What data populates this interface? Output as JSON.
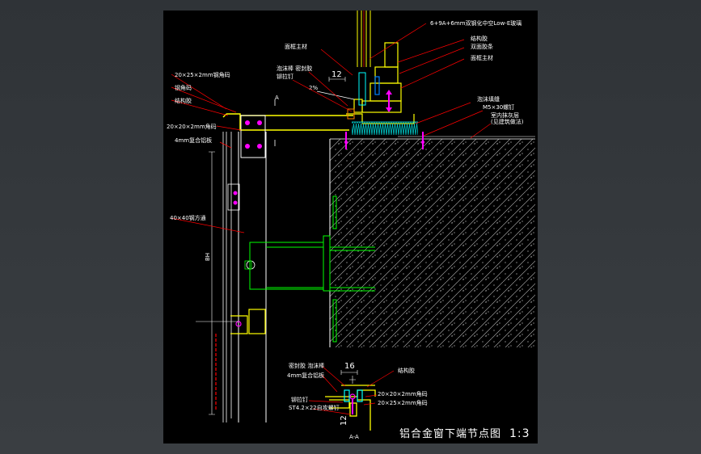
{
  "drawing": {
    "title": "铝合金窗下端节点图",
    "scale": "1:3",
    "section_mark": "A-A"
  },
  "labels": {
    "glass": "6+9A+6mm双钢化中空Low-E玻璃",
    "sealant_strip": "结构胶",
    "double_tape": "双面胶条",
    "face_frame": "面框主材",
    "pressure_plate": "面框主材",
    "gasket_seal": "泡沫棒 密封胶",
    "rivet": "铆拉钉",
    "weatherproof": "泡沫填缝",
    "bolt": "M5×30螺钉",
    "sealant_layer": "室内抹灰层",
    "sealant_layer2": "(见建筑做法)",
    "angle_l": "20×25×2mm钢角码",
    "steel_angle": "钢角码",
    "structure_glue": "结构胶",
    "angle_s": "20×20×2mm角码",
    "composite_panel": "4mm复合铝板",
    "steel_tube": "40×40钢方通",
    "width_mark": "2%",
    "b_sealant": "密封胶 泡沫棒",
    "b_panel": "4mm复合铝板",
    "b_rivet": "铆拉钉",
    "b_screw": "ST4.2×22自攻螺钉",
    "b_glue": "结构胶",
    "b_angle_s": "20×20×2mm角码",
    "b_angle_l": "20×25×2mm角码"
  },
  "dimensions": {
    "d12_top": "12",
    "d16": "16",
    "d12_bottom": "12",
    "overall": "BH"
  }
}
